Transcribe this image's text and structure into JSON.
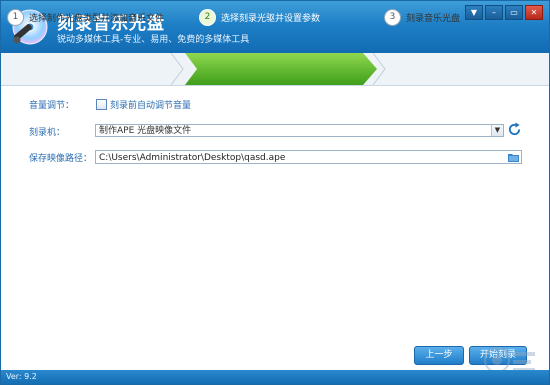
{
  "app": {
    "title": "刻录音乐光盘",
    "subtitle": "锐动多媒体工具-专业、易用、免费的多媒体工具",
    "version": "Ver: 9.2"
  },
  "window_buttons": [
    "▼",
    "–",
    "▭",
    "✕"
  ],
  "steps": [
    {
      "num": "1",
      "label": "选择制作光盘类型并添加音乐文件",
      "active": false
    },
    {
      "num": "2",
      "label": "选择刻录光驱并设置参数",
      "active": true
    },
    {
      "num": "3",
      "label": "刻录音乐光盘",
      "active": false
    }
  ],
  "form": {
    "volume_label": "音量调节：",
    "volume_checkbox_label": "刻录前自动调节音量",
    "volume_checked": false,
    "burner_label": "刻录机：",
    "burner_value": "制作APE 光盘映像文件",
    "path_label": "保存映像路径：",
    "path_value": "C:\\Users\\Administrator\\Desktop\\qasd.ape"
  },
  "buttons": {
    "prev": "上一步",
    "start": "开始刻录"
  },
  "colors": {
    "title_bar": "#1e7fc6",
    "active_step": "#5cb82a",
    "label_blue": "#2a6cb0"
  }
}
